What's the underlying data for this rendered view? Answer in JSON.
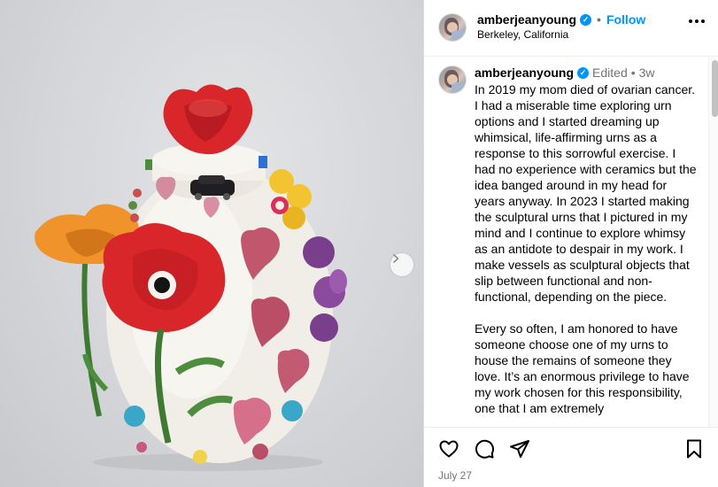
{
  "post": {
    "username": "amberjeanyoung",
    "verified_mark": "✓",
    "follow_label": "Follow",
    "separator": "•",
    "location": "Berkeley, California",
    "more_icon": "more-horizontal-icon"
  },
  "caption": {
    "username": "amberjeanyoung",
    "edited_label": "Edited",
    "separator": "•",
    "time": "3w",
    "text": "In 2019 my mom died of ovarian cancer. I had a miserable time exploring urn options and I started dreaming up whimsical, life-affirming urns as a response to this sorrowful exercise. I had no experience with ceramics but the idea banged around in my head for years anyway. In 2023 I started making the sculptural urns that I pictured in my mind and I continue to explore whimsy as an antidote to despair in my work. I make vessels as sculptural objects that slip between functional and non-functional, depending on the piece.\n\nEvery so often, I am honored to have someone choose one of my urns to house the remains of someone they love. It’s an enormous privilege to have my work chosen for this responsibility, one that I am extremely"
  },
  "actions": {
    "like_icon": "heart-icon",
    "comment_icon": "comment-icon",
    "share_icon": "share-icon",
    "save_icon": "bookmark-icon",
    "date": "July 27"
  },
  "media": {
    "next_icon": "chevron-right-icon"
  },
  "colors": {
    "accent": "#0095f6",
    "muted": "#737373",
    "poppy_red": "#d8262b",
    "poppy_orange": "#f0932b",
    "heart_pink": "#c1576d"
  }
}
